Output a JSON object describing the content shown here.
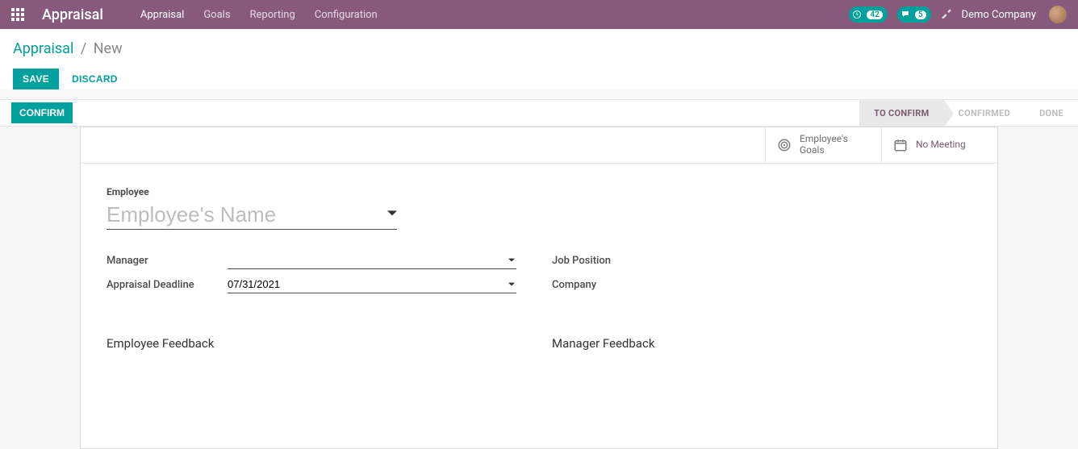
{
  "nav": {
    "brand": "Appraisal",
    "menu": [
      "Appraisal",
      "Goals",
      "Reporting",
      "Configuration"
    ],
    "clock_badge": "42",
    "chat_badge": "5",
    "company": "Demo Company"
  },
  "breadcrumb": {
    "root": "Appraisal",
    "sep": "/",
    "current": "New"
  },
  "actions": {
    "save": "SAVE",
    "discard": "DISCARD",
    "confirm": "CONFIRM"
  },
  "stages": {
    "to_confirm": "TO CONFIRM",
    "confirmed": "CONFIRMED",
    "done": "DONE"
  },
  "stat_buttons": {
    "goals_line1": "Employee's",
    "goals_line2": "Goals",
    "meeting": "No Meeting"
  },
  "form": {
    "employee_label": "Employee",
    "employee_placeholder": "Employee's Name",
    "manager_label": "Manager",
    "manager_value": "",
    "deadline_label": "Appraisal Deadline",
    "deadline_value": "07/31/2021",
    "jobpos_label": "Job Position",
    "jobpos_value": "",
    "company_label": "Company",
    "company_value": "",
    "emp_feedback": "Employee Feedback",
    "mgr_feedback": "Manager Feedback"
  }
}
